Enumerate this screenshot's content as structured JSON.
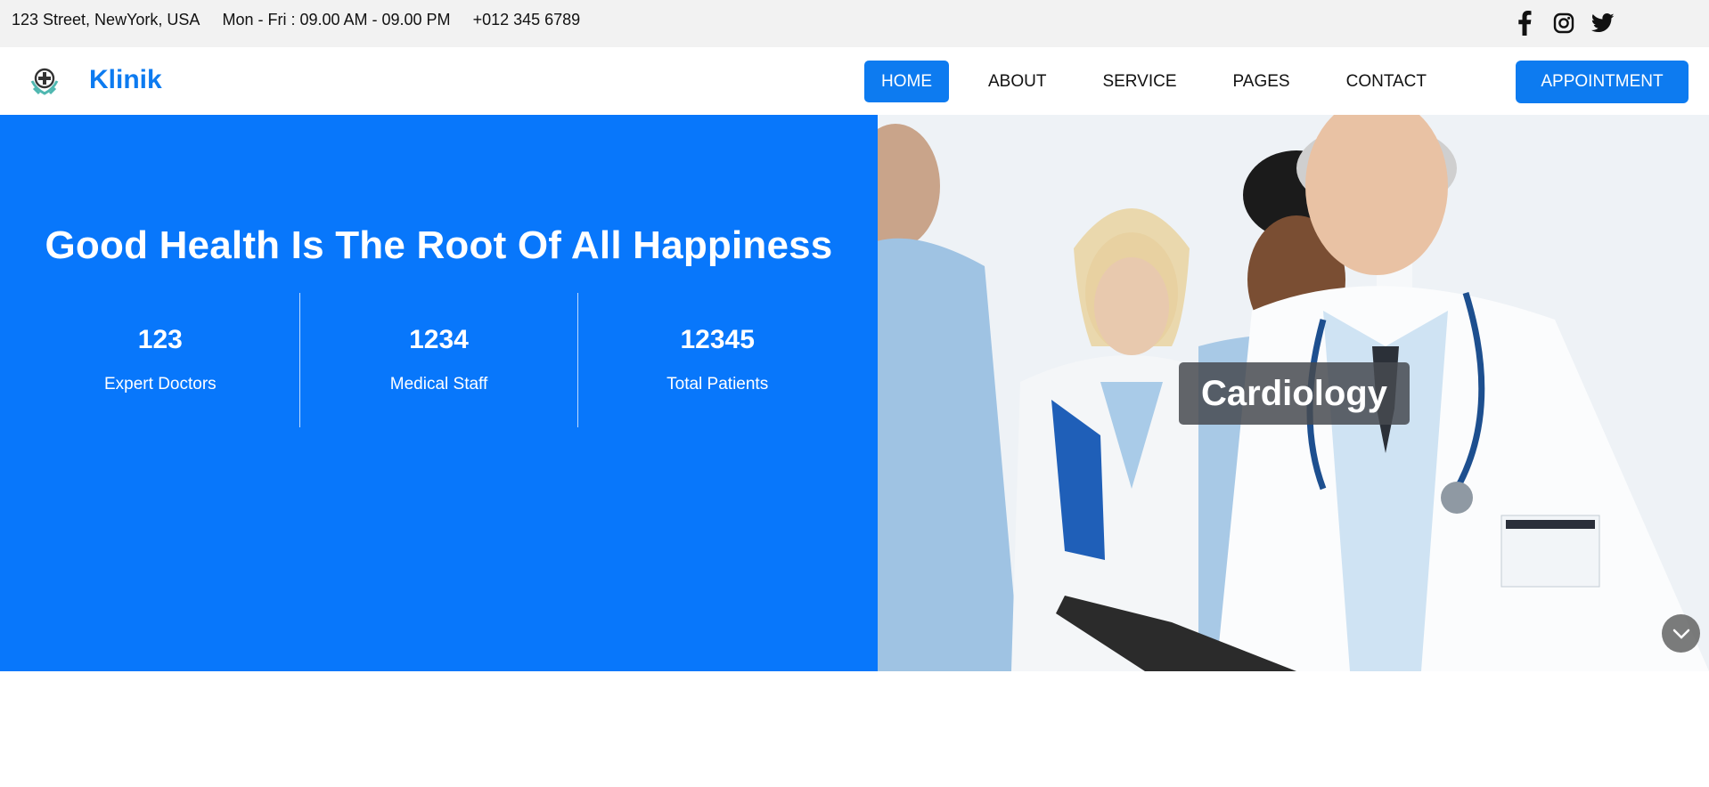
{
  "topbar": {
    "address": "123 Street, NewYork, USA",
    "hours": "Mon - Fri : 09.00 AM - 09.00 PM",
    "phone": "+012 345 6789",
    "social": [
      "facebook-icon",
      "instagram-icon",
      "twitter-icon"
    ]
  },
  "brand": {
    "name": "Klinik",
    "logo_icon": "medical-cross-logo"
  },
  "nav": {
    "items": [
      {
        "label": "HOME",
        "active": true
      },
      {
        "label": "ABOUT",
        "active": false
      },
      {
        "label": "SERVICE",
        "active": false
      },
      {
        "label": "PAGES",
        "active": false
      },
      {
        "label": "CONTACT",
        "active": false
      }
    ],
    "appointment_label": "APPOINTMENT"
  },
  "hero": {
    "title": "Good Health Is The Root Of All Happiness",
    "stats": [
      {
        "value": "123",
        "label": "Expert Doctors"
      },
      {
        "value": "1234",
        "label": "Medical Staff"
      },
      {
        "value": "12345",
        "label": "Total Patients"
      }
    ],
    "slide_caption": "Cardiology",
    "scroll_icon": "chevron-down-icon"
  },
  "colors": {
    "primary": "#0d7bf0",
    "hero_bg": "#0877fb",
    "topbar_bg": "#f2f2f2"
  }
}
